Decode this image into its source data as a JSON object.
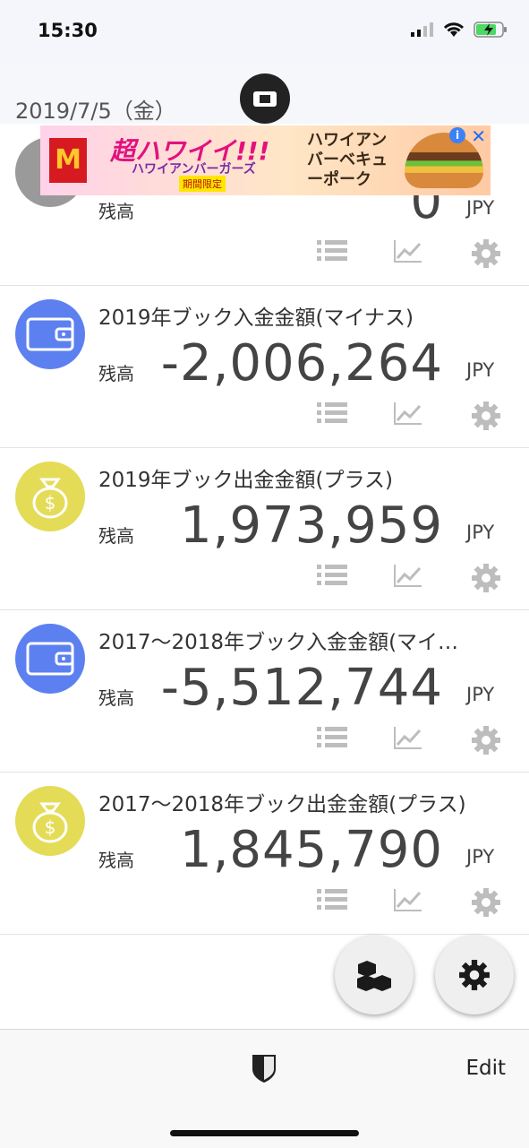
{
  "status": {
    "time": "15:30"
  },
  "header": {
    "date": "2019/7/5（金）"
  },
  "ad": {
    "title": "超ハワイイ!!!",
    "subtitle": "ハワイアンバーガーズ",
    "limited": "期間限定",
    "right_text": "ハワイアンバーベキューポーク",
    "info": "i",
    "close": "✕"
  },
  "books": [
    {
      "title": "",
      "balance_label": "残高",
      "balance": "0",
      "currency": "JPY",
      "icon": "lightbulb-icon",
      "color": "#9a9a9a"
    },
    {
      "title": "2019年ブック入金金額(マイナス)",
      "balance_label": "残高",
      "balance": "-2,006,264",
      "currency": "JPY",
      "icon": "wallet-icon",
      "color": "#5d80f0"
    },
    {
      "title": "2019年ブック出金金額(プラス)",
      "balance_label": "残高",
      "balance": "1,973,959",
      "currency": "JPY",
      "icon": "money-bag-icon",
      "color": "#e4dc57"
    },
    {
      "title": "2017〜2018年ブック入金金額(マイ…",
      "balance_label": "残高",
      "balance": "-5,512,744",
      "currency": "JPY",
      "icon": "wallet-icon",
      "color": "#5d80f0"
    },
    {
      "title": "2017〜2018年ブック出金金額(プラス)",
      "balance_label": "残高",
      "balance": "1,845,790",
      "currency": "JPY",
      "icon": "money-bag-icon",
      "color": "#e4dc57"
    }
  ],
  "tabbar": {
    "edit": "Edit"
  }
}
